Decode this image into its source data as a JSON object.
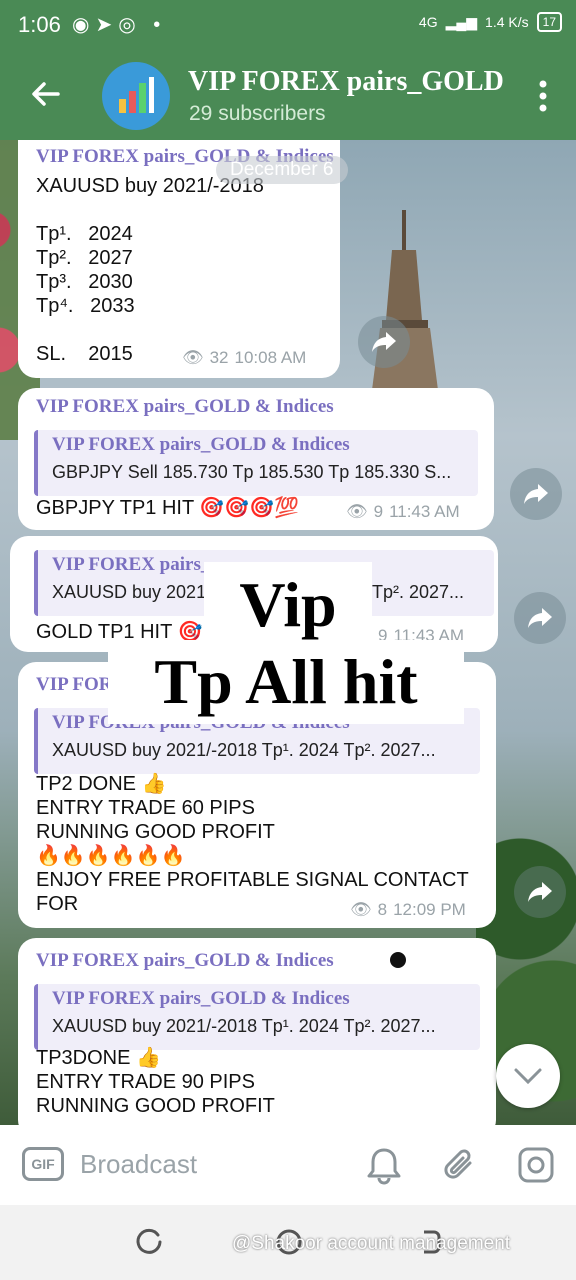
{
  "status_bar": {
    "time": "1:06",
    "network": "4G",
    "speed": "1.4 K/s",
    "battery": "17"
  },
  "header": {
    "title": "VIP FOREX pairs_GOLD",
    "subtitle": "29 subscribers"
  },
  "date_pill": "December 6",
  "messages": [
    {
      "sender": "VIP FOREX pairs_GOLD & Indices",
      "text": "XAUUSD buy 2021/-2018\n\nTp¹.   2024\nTp².   2027\nTp³.   2030\nTp⁴.   2033\n\nSL.    2015",
      "views": "32",
      "time": "10:08 AM"
    },
    {
      "sender": "VIP FOREX pairs_GOLD & Indices",
      "reply_name": "VIP FOREX pairs_GOLD & Indices",
      "reply_text": "GBPJPY Sell 185.730 Tp  185.530 Tp  185.330 S...",
      "text": "GBPJPY TP1 HIT 🎯🎯🎯💯",
      "views": "9",
      "time": "11:43 AM"
    },
    {
      "reply_name": "VIP FOREX pairs_",
      "reply_text": "XAUUSD buy 2021",
      "reply_text_tail": "Tp².   2027...",
      "text": "GOLD TP1 HIT 🎯",
      "views": "9",
      "time": "11:43 AM"
    },
    {
      "sender": "VIP FOR",
      "reply_name": "VIP FOREX pairs_GOLD & Indices",
      "reply_text": "XAUUSD buy 2021/-2018  Tp¹.   2024 Tp².   2027...",
      "text": "TP2 DONE 👍\nENTRY TRADE 60 PIPS\nRUNNING GOOD PROFIT\n🔥🔥🔥🔥🔥🔥\nENJOY FREE PROFITABLE SIGNAL CONTACT\nFOR",
      "views": "8",
      "time": "12:09 PM"
    },
    {
      "sender": "VIP FOREX pairs_GOLD & Indices",
      "reply_name": "VIP FOREX pairs_GOLD & Indices",
      "reply_text": "XAUUSD buy 2021/-2018  Tp¹.   2024 Tp².   2027...",
      "text": "TP3DONE 👍\nENTRY TRADE 90 PIPS\nRUNNING GOOD PROFIT"
    }
  ],
  "overlay": {
    "line1": "Vip",
    "line2": "Tp All hit"
  },
  "composer": {
    "gif_label": "GIF",
    "placeholder": "Broadcast"
  },
  "watermark": "@Shakoor account management",
  "colors": {
    "header": "#4a8a55",
    "sender": "#7a6fc0",
    "reply_bar": "#8578c8"
  }
}
